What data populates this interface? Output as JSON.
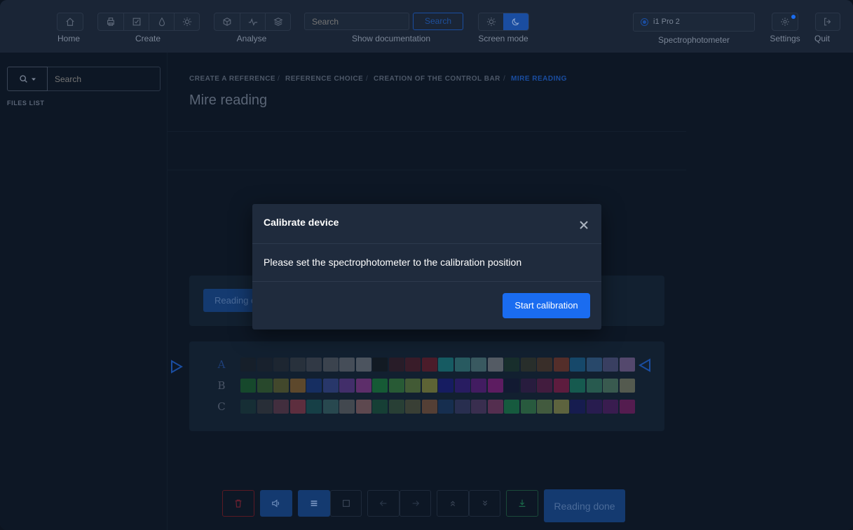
{
  "window": {
    "controls": [
      "close",
      "minimize",
      "zoom"
    ]
  },
  "toolbar": {
    "home_label": "Home",
    "create_label": "Create",
    "analyse_label": "Analyse",
    "search_placeholder": "Search",
    "search_button": "Search",
    "show_documentation": "Show documentation",
    "screen_mode_label": "Screen mode",
    "device_name": "i1 Pro 2",
    "spectrophotometer_label": "Spectrophotometer",
    "settings_label": "Settings",
    "quit_label": "Quit"
  },
  "sidebar": {
    "search_placeholder": "Search",
    "files_list": "FILES LIST"
  },
  "breadcrumb": [
    "CREATE A REFERENCE",
    "REFERENCE CHOICE",
    "CREATION OF THE CONTROL BAR",
    "MIRE READING"
  ],
  "page_title": "Mire reading",
  "reading_button_partial": "Reading c",
  "chart_rows": {
    "labels": [
      "A",
      "B",
      "C"
    ],
    "A": [
      "#1a1f26",
      "#1d232b",
      "#262b33",
      "#3a3f47",
      "#4a4f57",
      "#5d6168",
      "#6f737a",
      "#7c8087",
      "#121519",
      "#3a1a22",
      "#5a1a24",
      "#7a1a26",
      "#1a8c8c",
      "#3a8a88",
      "#5a8888",
      "#8a8d90",
      "#1d3a2a",
      "#3a3a28",
      "#5a3a24",
      "#8a3a26",
      "#1a6a9a",
      "#3a6a9a",
      "#5a5a8a",
      "#8a6aa0"
    ],
    "B": [
      "#1a6a2a",
      "#3a6a2a",
      "#6a6a2a",
      "#9a6a2a",
      "#1a3a8a",
      "#3a4a9a",
      "#6a3a9a",
      "#9a3a9a",
      "#1a8a3a",
      "#3a8a3a",
      "#6a8a3a",
      "#9a9a3a",
      "#1a1a8a",
      "#3a1a8a",
      "#6a1a8a",
      "#9a1a8a",
      "#121635",
      "#3a1a4a",
      "#6a1a4a",
      "#9a1a4a",
      "#1a8a6a",
      "#3a8a6a",
      "#5a8a6a",
      "#8a8a6a"
    ],
    "C": [
      "#1a3a3a",
      "#3a3a3e",
      "#6a3a4a",
      "#9a3a4a",
      "#1a5a5a",
      "#3a6a6a",
      "#6a6a6a",
      "#9a6a6a",
      "#1a5a3a",
      "#3a5a3a",
      "#5a5a3a",
      "#8a5a3a",
      "#1a3a6a",
      "#3a3a6a",
      "#5a3a6a",
      "#8a3a6a",
      "#1a8a4a",
      "#3a8a4a",
      "#6a8a4a",
      "#9a9a4a",
      "#1a1a6a",
      "#3a1a6a",
      "#5a1a6a",
      "#8a1a6a"
    ]
  },
  "bottom_bar": {
    "reading_done": "Reading done"
  },
  "modal": {
    "title": "Calibrate device",
    "message": "Please set the spectrophotometer to the calibration position",
    "start_button": "Start calibration"
  },
  "colors": {
    "accent": "#1a6cf0",
    "background": "#0d1725"
  }
}
